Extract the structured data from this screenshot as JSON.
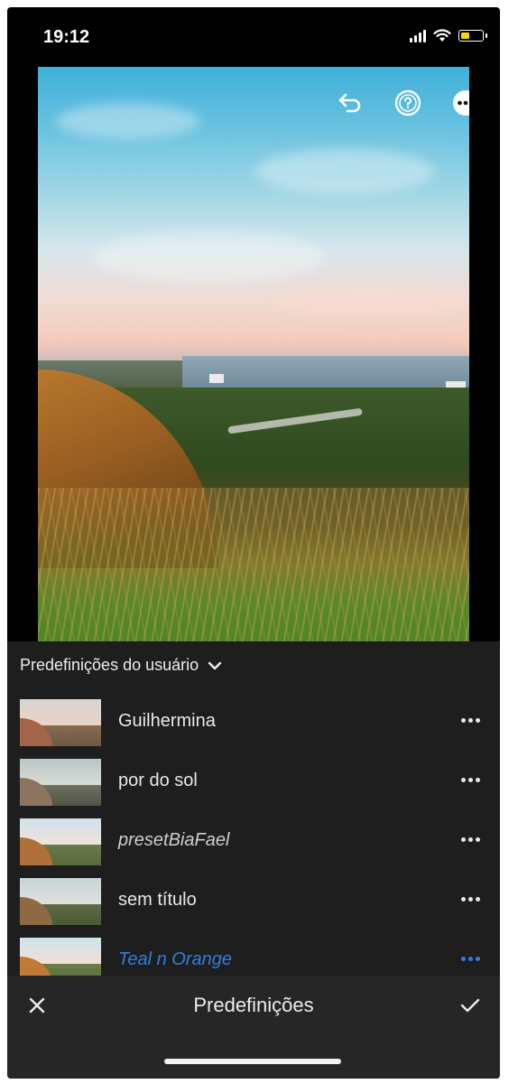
{
  "status_bar": {
    "time": "19:12",
    "battery_color": "#f5d90a"
  },
  "photo_toolbar": {
    "icons": [
      "undo-icon",
      "help-icon",
      "more-icon"
    ]
  },
  "presets_panel": {
    "header": "Predefinições do usuário",
    "items": [
      {
        "label": "Guilhermina",
        "italic": false,
        "active": false
      },
      {
        "label": "por do sol",
        "italic": false,
        "active": false
      },
      {
        "label": "presetBiaFael",
        "italic": true,
        "active": false
      },
      {
        "label": "sem título",
        "italic": false,
        "active": false
      },
      {
        "label": "Teal n Orange",
        "italic": true,
        "active": true
      }
    ],
    "active_color": "#2f7fe0"
  },
  "footer": {
    "title": "Predefinições",
    "cancel_icon": "close-icon",
    "confirm_icon": "checkmark-icon"
  }
}
